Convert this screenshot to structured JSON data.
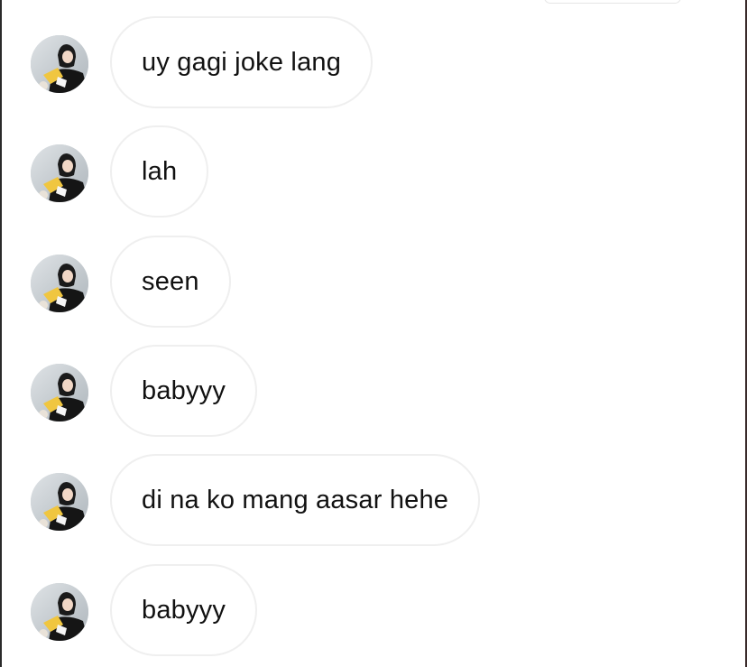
{
  "thread": {
    "messages": [
      {
        "text": "uy gagi joke lang"
      },
      {
        "text": "lah"
      },
      {
        "text": "seen"
      },
      {
        "text": "babyyy"
      },
      {
        "text": "di na ko mang aasar hehe"
      },
      {
        "text": "babyyy"
      }
    ]
  },
  "icons": {
    "avatar": "profile-photo-avatar"
  },
  "colors": {
    "bubble_border": "#efefef",
    "text": "#111111",
    "background": "#ffffff"
  }
}
